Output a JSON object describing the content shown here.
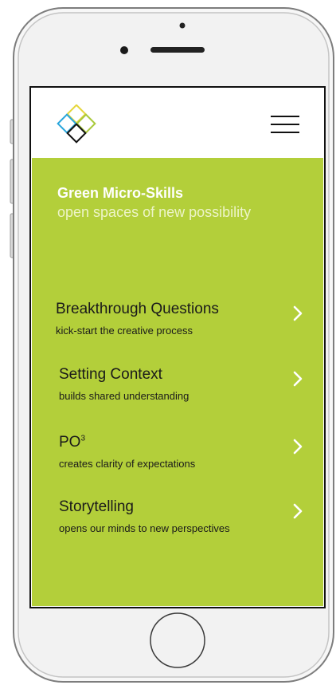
{
  "app": {
    "colors": {
      "accent": "#b3cf3a",
      "header_bg": "#ffffff",
      "text_dark": "#1a1a1a",
      "chevron": "#ffffff"
    },
    "header": {
      "logo": "diamond-logo-icon",
      "menu_icon": "hamburger-menu-icon"
    },
    "hero": {
      "title": "Green Micro-Skills",
      "subtitle": "open spaces of new possibility"
    },
    "skills": [
      {
        "title": "Breakthrough Questions",
        "subtitle": "kick-start the creative process"
      },
      {
        "title": "Setting Context",
        "subtitle": "builds shared understanding"
      },
      {
        "title": "PO",
        "title_superscript": "3",
        "subtitle": "creates clarity of expectations"
      },
      {
        "title": "Storytelling",
        "subtitle": "opens our minds to new perspectives"
      }
    ]
  }
}
